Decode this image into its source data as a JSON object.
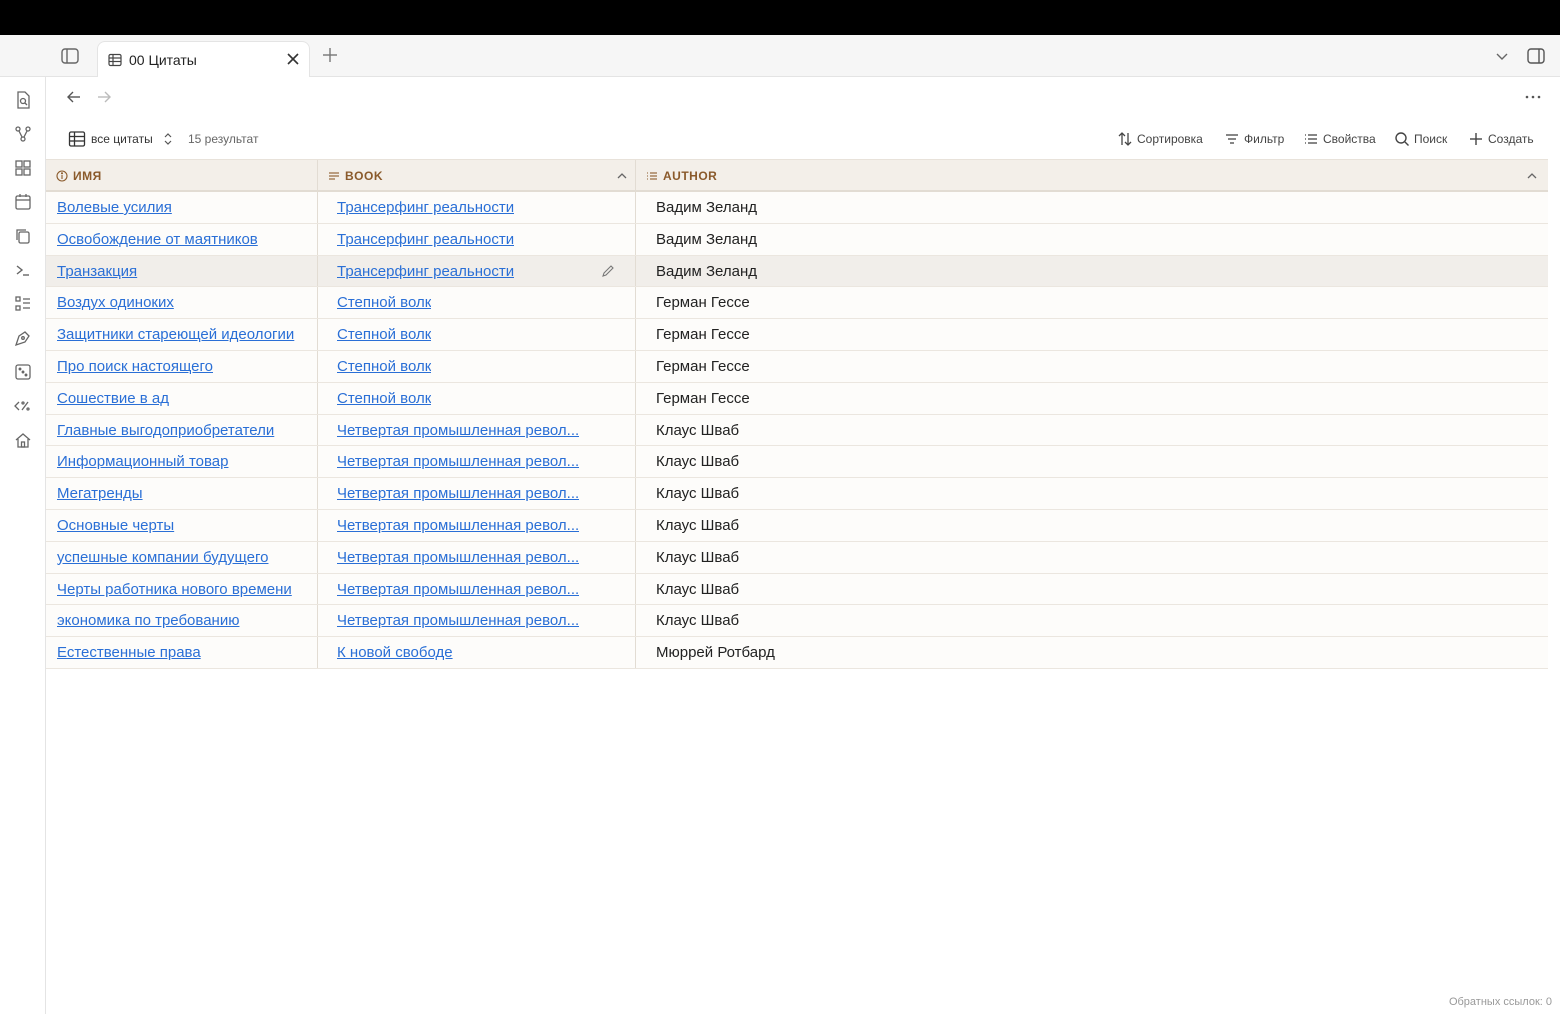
{
  "tab": {
    "title": "00 Цитаты"
  },
  "toolbar": {
    "view_name": "все цитаты",
    "result_count": "15 результат",
    "sort_label": "Сортировка",
    "filter_label": "Фильтр",
    "properties_label": "Свойства",
    "search_label": "Поиск",
    "create_label": "Создать"
  },
  "table": {
    "columns": [
      "ИМЯ",
      "BOOK",
      "AUTHOR"
    ],
    "rows": [
      {
        "name": "Волевые усилия",
        "book": "Трансерфинг реальности",
        "author": "Вадим Зеланд"
      },
      {
        "name": "Освобождение от маятников",
        "book": "Трансерфинг реальности",
        "author": "Вадим Зеланд"
      },
      {
        "name": "Транзакция",
        "book": "Трансерфинг реальности",
        "author": "Вадим Зеланд"
      },
      {
        "name": "Воздух одиноких",
        "book": "Степной волк",
        "author": "Герман Гессе"
      },
      {
        "name": "Защитники стареющей идеологии",
        "book": "Степной волк",
        "author": "Герман Гессе"
      },
      {
        "name": "Про поиск настоящего",
        "book": "Степной волк",
        "author": "Герман Гессе"
      },
      {
        "name": "Сошествие в ад",
        "book": "Степной волк",
        "author": "Герман Гессе"
      },
      {
        "name": "Главные выгодоприобретатели",
        "book": "Четвертая промышленная револ...",
        "author": "Клаус Шваб"
      },
      {
        "name": "Информационный товар",
        "book": "Четвертая промышленная револ...",
        "author": "Клаус Шваб"
      },
      {
        "name": "Мегатренды",
        "book": "Четвертая промышленная револ...",
        "author": "Клаус Шваб"
      },
      {
        "name": "Основные черты",
        "book": "Четвертая промышленная револ...",
        "author": "Клаус Шваб"
      },
      {
        "name": "успешные компании будущего",
        "book": "Четвертая промышленная револ...",
        "author": "Клаус Шваб"
      },
      {
        "name": "Черты работника нового времени",
        "book": "Четвертая промышленная револ...",
        "author": "Клаус Шваб"
      },
      {
        "name": "экономика по требованию",
        "book": "Четвертая промышленная револ...",
        "author": "Клаус Шваб"
      },
      {
        "name": "Естественные права",
        "book": "К новой свободе",
        "author": "Мюррей Ротбард"
      }
    ]
  },
  "footer": {
    "backlinks": "Обратных ссылок: 0"
  },
  "colors": {
    "link": "#2a6fd6",
    "header_bg": "#f3efe9",
    "header_text": "#8a5a2b",
    "highlight_row": "#f1eeea"
  }
}
